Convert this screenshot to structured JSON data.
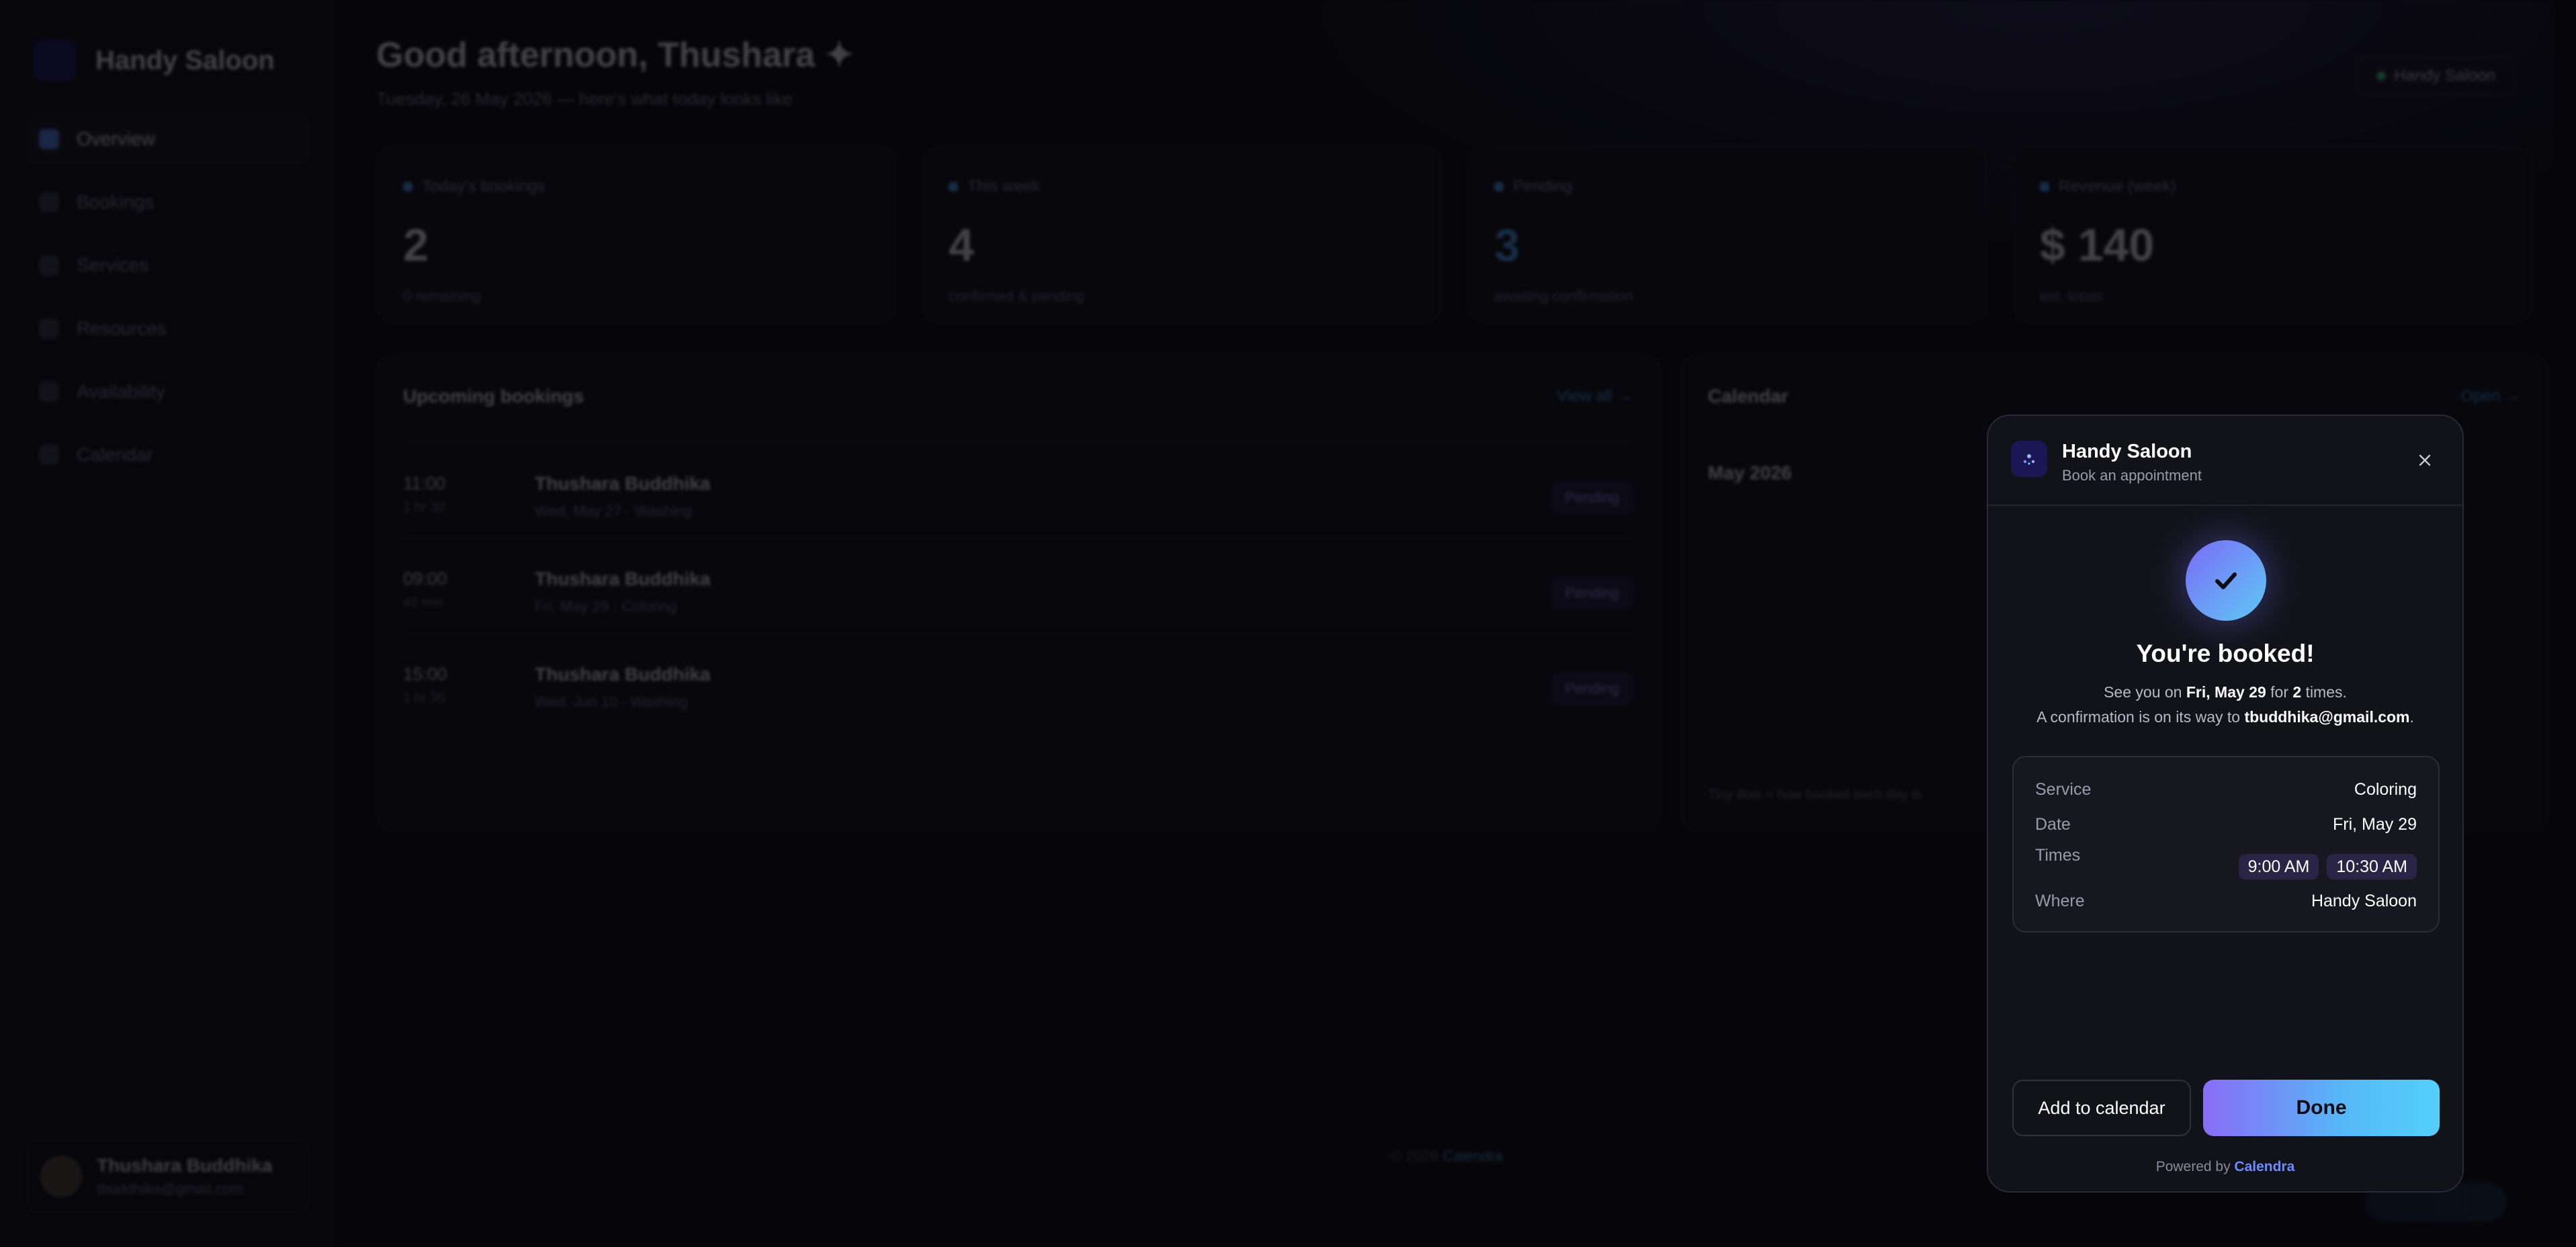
{
  "sidebar": {
    "brand": "Handy Saloon",
    "items": [
      {
        "label": "Overview",
        "active": true
      },
      {
        "label": "Bookings"
      },
      {
        "label": "Services"
      },
      {
        "label": "Resources"
      },
      {
        "label": "Availability"
      },
      {
        "label": "Calendar"
      }
    ],
    "user": {
      "name": "Thushara Buddhika",
      "email": "tbuddhika@gmail.com"
    }
  },
  "header": {
    "greeting": "Good afternoon, Thushara ✦",
    "subtitle": "Tuesday, 26 May 2026 — here's what today looks like",
    "shop_pill": "Handy Saloon"
  },
  "stats": [
    {
      "label": "Today's bookings",
      "value": "2",
      "sub": "0 remaining"
    },
    {
      "label": "This week",
      "value": "4",
      "sub": "confirmed & pending"
    },
    {
      "label": "Pending",
      "value": "3",
      "sub": "awaiting confirmation"
    },
    {
      "label": "Revenue (week)",
      "value": "$ 140",
      "sub": "est. totals"
    }
  ],
  "upcoming": {
    "title": "Upcoming bookings",
    "view_all": "View all →",
    "bookings": [
      {
        "time": "11:00",
        "duration": "1 hr 30",
        "name": "Thushara Buddhika",
        "detail": "Wed, May 27 · Washing",
        "status": "Pending"
      },
      {
        "time": "09:00",
        "duration": "45 min",
        "name": "Thushara Buddhika",
        "detail": "Fri, May 29 · Coloring",
        "status": "Pending"
      },
      {
        "time": "15:00",
        "duration": "1 hr 30",
        "name": "Thushara Buddhika",
        "detail": "Wed, Jun 10 · Washing",
        "status": "Pending"
      }
    ]
  },
  "calendar_panel": {
    "title": "Calendar",
    "open_link": "Open →",
    "month": "May 2026",
    "note": "Tiny dots = how booked each day is"
  },
  "footer": {
    "text": "© 2026 ",
    "link": "Calendra"
  },
  "modal": {
    "shop_name": "Handy Saloon",
    "subtitle": "Book an appointment",
    "heading": "You're booked!",
    "line1_pre": "See you on ",
    "line1_date": "Fri, May 29",
    "line1_mid": " for ",
    "line1_count": "2",
    "line1_post": " times.",
    "line2_pre": "A confirmation is on its way to ",
    "line2_email": "tbuddhika@gmail.com",
    "line2_post": ".",
    "details": {
      "service_label": "Service",
      "service_value": "Coloring",
      "date_label": "Date",
      "date_value": "Fri, May 29",
      "times_label": "Times",
      "times": [
        "9:00 AM",
        "10:30 AM"
      ],
      "where_label": "Where",
      "where_value": "Handy Saloon"
    },
    "add_to_calendar": "Add to calendar",
    "done": "Done",
    "powered_by": "Powered by ",
    "powered_brand": "Calendra"
  },
  "colors": {
    "accent_gradient_start": "#8a6cf7",
    "accent_gradient_end": "#54d0f9",
    "background": "#07070b",
    "modal_background": "#121219"
  }
}
